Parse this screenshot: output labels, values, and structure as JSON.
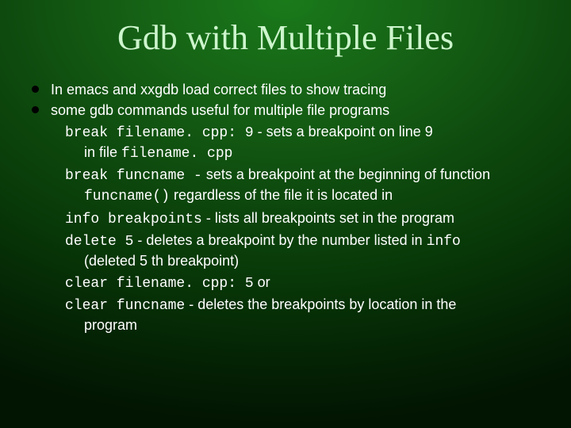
{
  "title": "Gdb with Multiple Files",
  "b1": "In emacs and xxgdb load correct files to show tracing",
  "b2": "some gdb commands useful for multiple file programs",
  "s1_cmd": "break filename. cpp: 9",
  "s1_txt": " - sets a breakpoint on line 9",
  "s1_c1": "in file ",
  "s1_c2": "filename. cpp",
  "s2_cmd": "break funcname -",
  "s2_txt": " sets a breakpoint at the beginning of function",
  "s2_c1": "funcname()",
  "s2_c2": " regardless of the file it is located in",
  "s3_cmd": "info breakpoints",
  "s3_txt": " - lists all breakpoints set in the program",
  "s4_cmd": "delete 5",
  "s4_txt": " - deletes a breakpoint by the number listed in ",
  "s4_cmd2": "info",
  "s4_c1": "(deleted 5 th breakpoint)",
  "s5_cmd": "clear filename. cpp: 5",
  "s5_txt": " or",
  "s6_cmd": "clear funcname",
  "s6_txt": " - deletes the breakpoints by location in the",
  "s6_c1": "program"
}
